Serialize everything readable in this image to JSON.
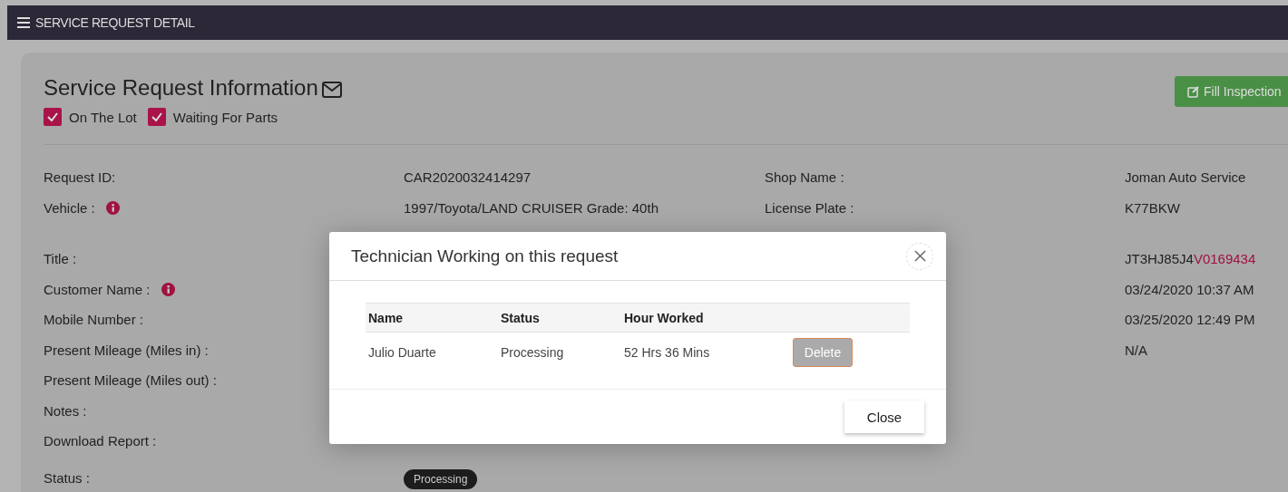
{
  "header": {
    "title": "SERVICE REQUEST DETAIL"
  },
  "card": {
    "title": "Service Request Information",
    "action": "Fill Inspection",
    "flags": [
      {
        "label": "On The Lot",
        "checked": true
      },
      {
        "label": "Waiting For Parts",
        "checked": true
      }
    ],
    "rows": [
      {
        "label": "Request ID:",
        "info": false,
        "value": "CAR2020032414297",
        "kind": "text",
        "right_label": "Shop Name :",
        "right_value": "Joman Auto Service"
      },
      {
        "label": "Vehicle :",
        "info": true,
        "value": "1997/Toyota/LAND CRUISER Grade: 40th",
        "kind": "text",
        "right_label": "License Plate :",
        "right_value": "K77BKW"
      },
      {
        "label": "Title :",
        "info": false,
        "right_value": "JT3HJ85J4",
        "right_highlight": "V0169434"
      },
      {
        "label": "Customer Name :",
        "info": true,
        "right_value": "03/24/2020 10:37 AM"
      },
      {
        "label": "Mobile Number :",
        "info": false,
        "right_value": "03/25/2020 12:49 PM"
      },
      {
        "label": "Present Mileage (Miles in) :",
        "info": false,
        "right_value": "N/A"
      },
      {
        "label": "Present Mileage (Miles out) :",
        "info": false
      },
      {
        "label": "Notes :",
        "info": false
      },
      {
        "label": "Download Report :",
        "info": false
      },
      {
        "label": "Status :",
        "info": false,
        "value": "Processing",
        "kind": "badge"
      }
    ]
  },
  "modal": {
    "title": "Technician Working on this request",
    "columns": [
      "Name",
      "Status",
      "Hour Worked"
    ],
    "rows": [
      {
        "name": "Julio Duarte",
        "status": "Processing",
        "hours": "52 Hrs 36 Mins",
        "action": "Delete"
      }
    ],
    "close_button": "Close"
  }
}
